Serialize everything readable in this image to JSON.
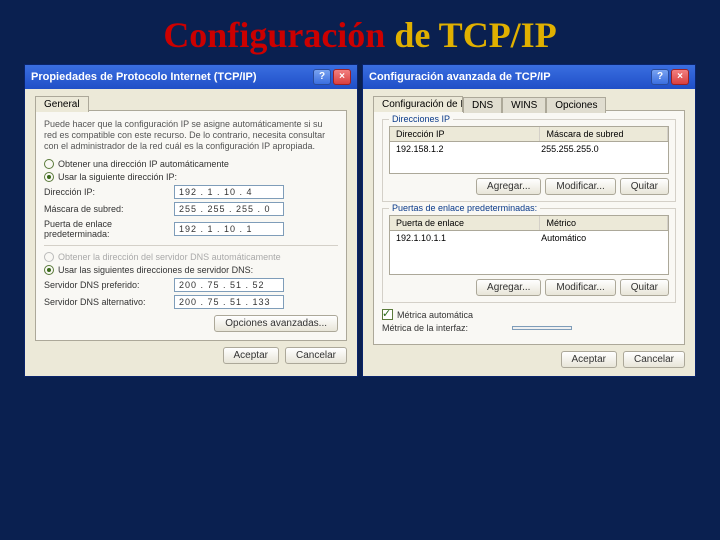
{
  "title": {
    "part1": "Configuración",
    "part2": " de TCP/IP"
  },
  "dlg1": {
    "caption": "Propiedades de Protocolo Internet (TCP/IP)",
    "tab": "General",
    "desc": "Puede hacer que la configuración IP se asigne automáticamente si su red es compatible con este recurso. De lo contrario, necesita consultar con el administrador de la red cuál es la configuración IP apropiada.",
    "radio_auto_ip": "Obtener una dirección IP automáticamente",
    "radio_manual_ip": "Usar la siguiente dirección IP:",
    "field_ip": "Dirección IP:",
    "field_mask": "Máscara de subred:",
    "field_gw": "Puerta de enlace predeterminada:",
    "val_ip": "192 .  1 . 10 .  4",
    "val_mask": "255 . 255 . 255 .  0",
    "val_gw": "192 .  1 . 10 .  1",
    "radio_auto_dns": "Obtener la dirección del servidor DNS automáticamente",
    "radio_manual_dns": "Usar las siguientes direcciones de servidor DNS:",
    "field_dns1": "Servidor DNS preferido:",
    "field_dns2": "Servidor DNS alternativo:",
    "val_dns1": "200 . 75 . 51 .  52",
    "val_dns2": "200 . 75 . 51 . 133",
    "btn_adv": "Opciones avanzadas...",
    "btn_ok": "Aceptar",
    "btn_cancel": "Cancelar"
  },
  "dlg2": {
    "caption": "Configuración avanzada de TCP/IP",
    "tabs": {
      "t1": "Configuración de IP",
      "t2": "DNS",
      "t3": "WINS",
      "t4": "Opciones"
    },
    "group_ip": "Direcciones IP",
    "col_ip": "Dirección IP",
    "col_mask": "Máscara de subred",
    "row_ip": "192.158.1.2",
    "row_mask": "255.255.255.0",
    "group_gw": "Puertas de enlace predeterminadas:",
    "col_gw": "Puerta de enlace",
    "col_metric": "Métrico",
    "row_gw": "192.1.10.1.1",
    "row_metric": "Automático",
    "btn_add": "Agregar...",
    "btn_edit": "Modificar...",
    "btn_del": "Quitar",
    "chk_auto": "Métrica automática",
    "lbl_metric": "Métrica de la interfaz:",
    "btn_ok": "Aceptar",
    "btn_cancel": "Cancelar"
  }
}
